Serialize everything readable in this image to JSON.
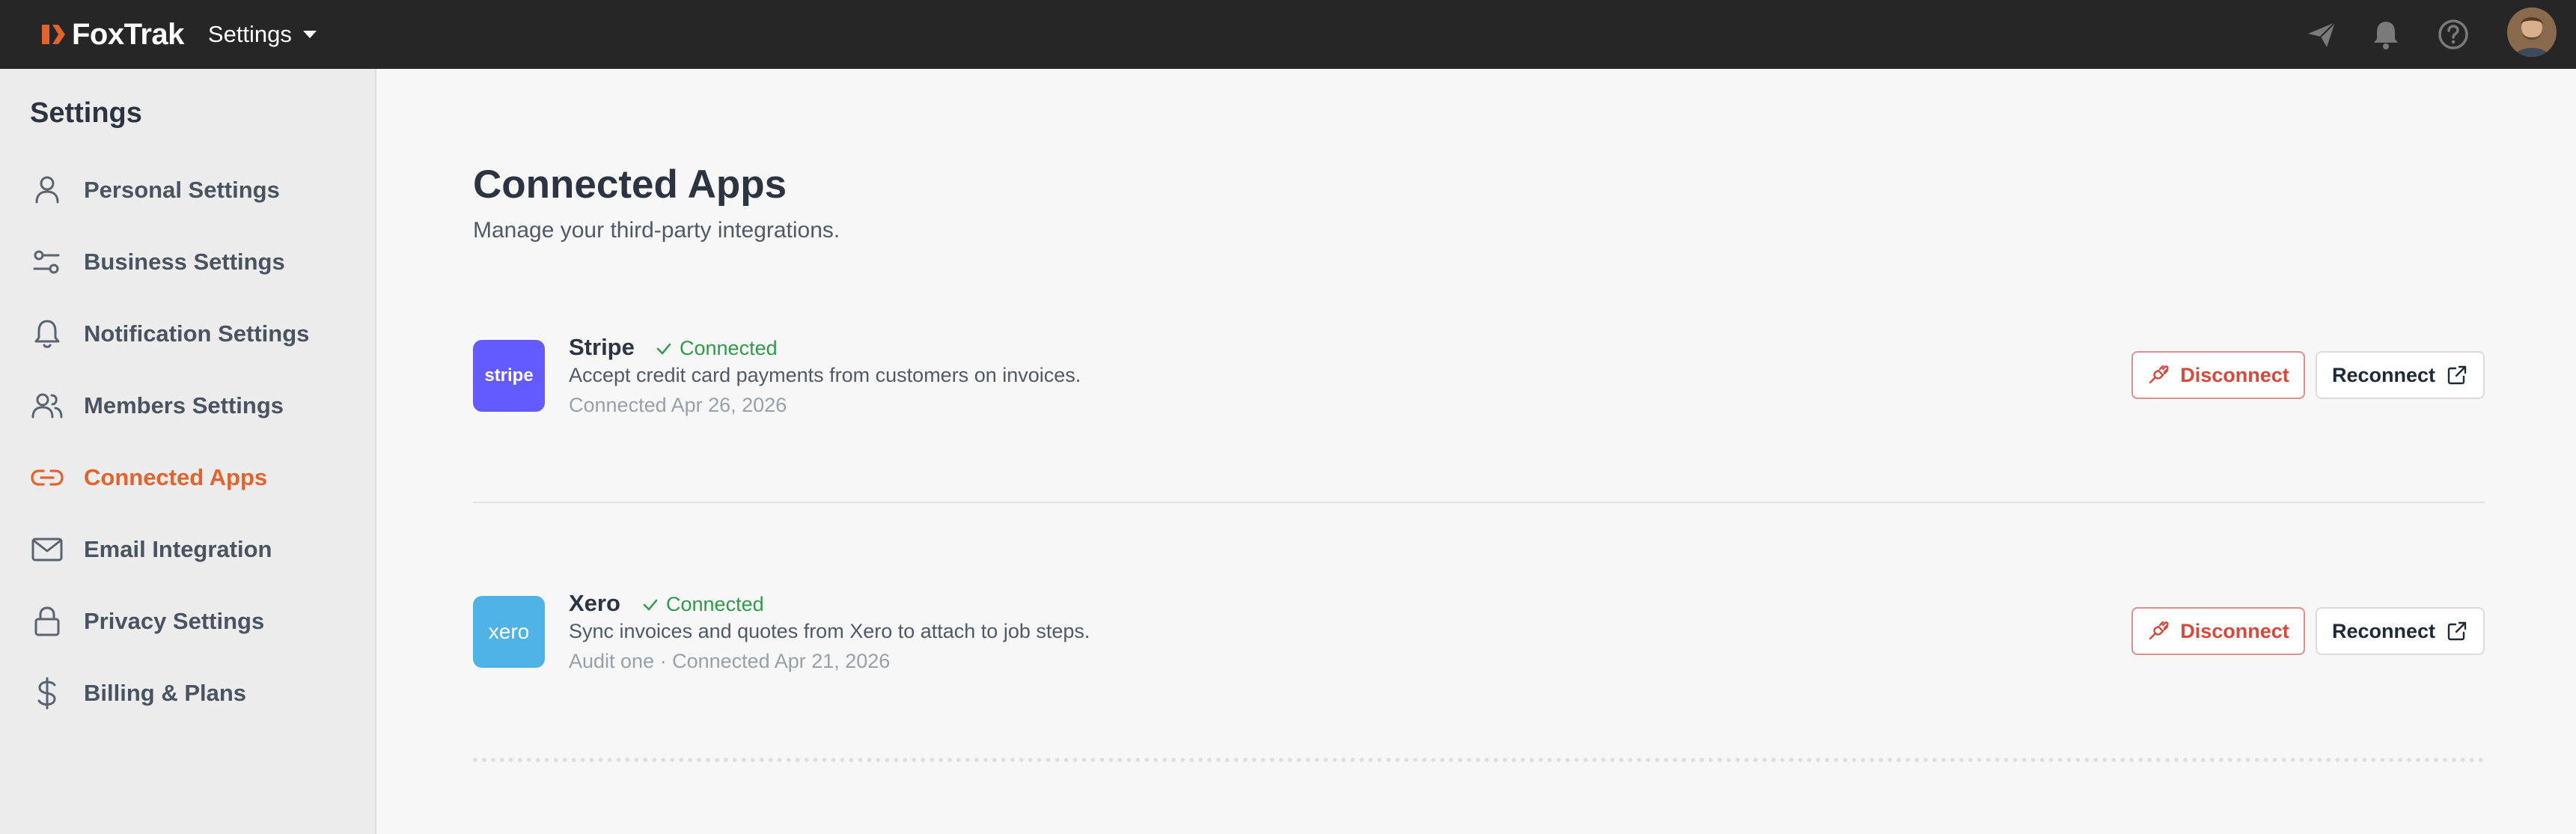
{
  "brand": {
    "name": "FoxTrak",
    "accent": "#e2632c"
  },
  "topbar": {
    "context_label": "Settings",
    "icons": [
      "send-icon",
      "bell-icon",
      "help-icon"
    ],
    "background": "#262626"
  },
  "sidebar": {
    "title": "Settings",
    "items": [
      {
        "label": "Personal Settings",
        "icon": "user-icon",
        "active": false
      },
      {
        "label": "Business Settings",
        "icon": "sliders-icon",
        "active": false
      },
      {
        "label": "Notification Settings",
        "icon": "bell-icon",
        "active": false
      },
      {
        "label": "Members Settings",
        "icon": "users-icon",
        "active": false
      },
      {
        "label": "Connected Apps",
        "icon": "link-icon",
        "active": true
      },
      {
        "label": "Email Integration",
        "icon": "mail-icon",
        "active": false
      },
      {
        "label": "Privacy Settings",
        "icon": "lock-icon",
        "active": false
      },
      {
        "label": "Billing & Plans",
        "icon": "dollar-icon",
        "active": false
      }
    ]
  },
  "main": {
    "title": "Connected Apps",
    "subtitle": "Manage your third-party integrations.",
    "apps": [
      {
        "name": "Stripe",
        "logo_text": "stripe",
        "logo_color": "#635bff",
        "status": "Connected",
        "description": "Accept credit card payments from customers on invoices.",
        "meta": "Connected Apr 26, 2026",
        "disconnect_label": "Disconnect",
        "reconnect_label": "Reconnect"
      },
      {
        "name": "Xero",
        "logo_text": "xero",
        "logo_color": "#4fb3e6",
        "status": "Connected",
        "description": "Sync invoices and quotes from Xero to attach to job steps.",
        "meta": "Audit one · Connected Apr 21, 2026",
        "disconnect_label": "Disconnect",
        "reconnect_label": "Reconnect"
      }
    ]
  }
}
